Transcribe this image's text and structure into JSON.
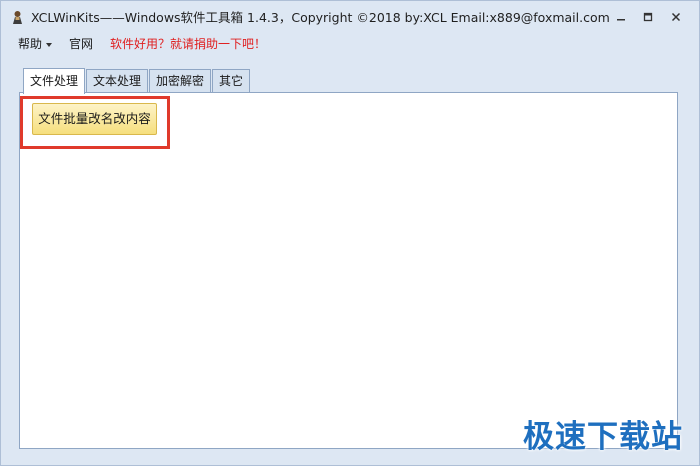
{
  "window": {
    "title": "XCLWinKits——Windows软件工具箱   1.4.3，Copyright ©2018 by:XCL Email:x889@foxmail.com",
    "icon": "app-figure-icon",
    "controls": [
      "minimize-icon",
      "restore-icon",
      "close-icon"
    ]
  },
  "menubar": {
    "help": "帮助",
    "website": "官网",
    "promo": "软件好用？就请捐助一下吧！"
  },
  "tabs": [
    {
      "label": "文件处理",
      "active": true
    },
    {
      "label": "文本处理",
      "active": false
    },
    {
      "label": "加密解密",
      "active": false
    },
    {
      "label": "其它",
      "active": false
    }
  ],
  "panel": {
    "batch_rename_button": "文件批量改名改内容"
  },
  "watermark": "极速下载站",
  "colors": {
    "highlight": "#e03a2b",
    "promo_text": "#e01f1f",
    "button_fill": "#f6df7d",
    "watermark": "#1e6fbf"
  }
}
